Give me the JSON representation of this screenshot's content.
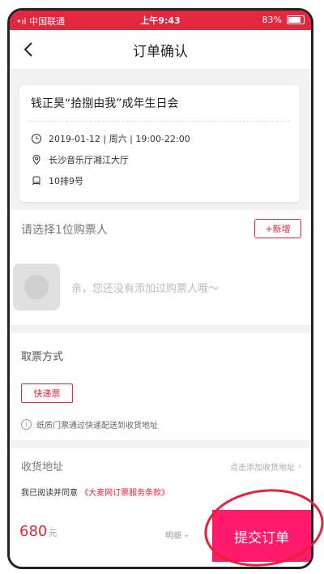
{
  "status_bar": {
    "carrier": "•ıl 中国联通",
    "time": "上午9:43",
    "battery": "83%"
  },
  "nav": {
    "title": "订单确认",
    "back_icon": "chevron-left-icon"
  },
  "event": {
    "name": "钱正昊“拾捌由我”成年生日会",
    "datetime": "2019-01-12 | 周六 | 19:00-22:00",
    "venue": "长沙音乐厅湘江大厅",
    "seat": "10排9号"
  },
  "buyer": {
    "title": "请选择1位购票人",
    "add_label": "+新增",
    "empty_message": "亲，您还没有添加过购票人哦～"
  },
  "pickup": {
    "title": "取票方式",
    "option_label": "快递票",
    "hint": "纸质门票通过快递配送到收货地址"
  },
  "address": {
    "title": "收货地址",
    "placeholder": "点击添加收货地址",
    "agree_prefix": "我已阅读并同意",
    "agree_link": "《大麦网订票服务条款》"
  },
  "footer": {
    "price": "680",
    "unit": "元",
    "detail_label": "明细",
    "submit_label": "提交订单"
  },
  "colors": {
    "brand": "#e4263f",
    "submit": "#ff1a6a",
    "annotation": "#e6213a"
  }
}
